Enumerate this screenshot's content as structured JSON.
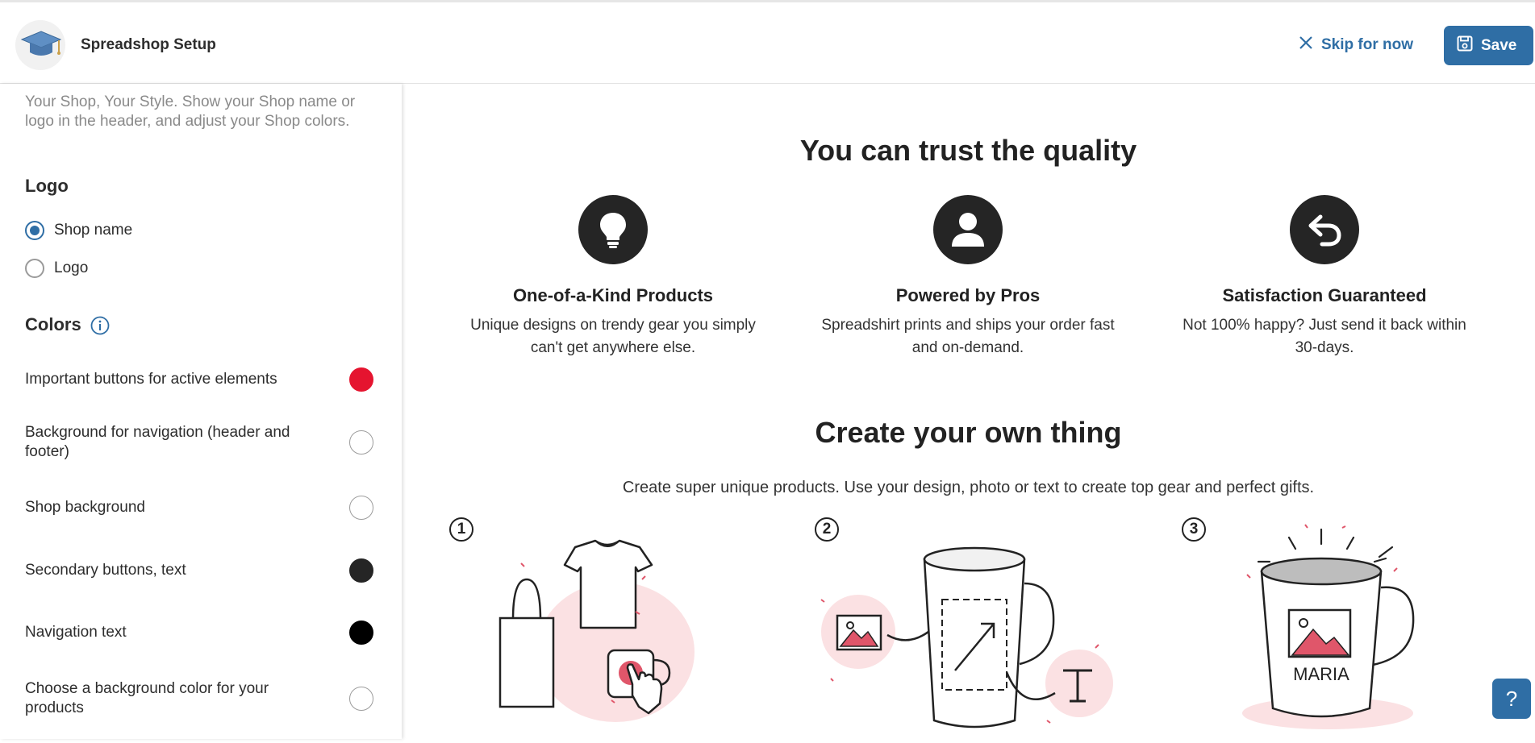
{
  "header": {
    "title": "Spreadshop Setup",
    "skip_label": "Skip for now",
    "save_label": "Save"
  },
  "sidebar": {
    "intro": "Your Shop, Your Style. Show your Shop name or logo in the header, and adjust your Shop colors.",
    "logo_title": "Logo",
    "logo_options": [
      {
        "label": "Shop name",
        "selected": true
      },
      {
        "label": "Logo",
        "selected": false
      }
    ],
    "colors_title": "Colors",
    "colors": [
      {
        "label": "Important buttons for active elements",
        "color": "#e5142f"
      },
      {
        "label": "Background for navigation (header and footer)",
        "color": "#ffffff"
      },
      {
        "label": "Shop background",
        "color": "#ffffff"
      },
      {
        "label": "Secondary buttons, text",
        "color": "#252525"
      },
      {
        "label": "Navigation text",
        "color": "#000000"
      },
      {
        "label": "Choose a background color for your products",
        "color": "#ffffff"
      }
    ]
  },
  "main": {
    "quality_title": "You can trust the quality",
    "features": [
      {
        "icon": "lightbulb-icon",
        "title": "One-of-a-Kind Products",
        "desc": "Unique designs on trendy gear you simply can't get anywhere else."
      },
      {
        "icon": "person-icon",
        "title": "Powered by Pros",
        "desc": "Spreadshirt prints and ships your order fast and on-demand."
      },
      {
        "icon": "return-arrow-icon",
        "title": "Satisfaction Guaranteed",
        "desc": "Not 100% happy? Just send it back within 30-days."
      }
    ],
    "create_title": "Create your own thing",
    "create_desc": "Create super unique products. Use your design, photo or text to create top gear and perfect gifts.",
    "steps": [
      "1",
      "2",
      "3"
    ],
    "mug_name": "MARIA"
  },
  "help_label": "?",
  "colors": {
    "accent": "#2f6ea5",
    "pink": "#fbe1e3",
    "pink_strong": "#e0566a"
  }
}
